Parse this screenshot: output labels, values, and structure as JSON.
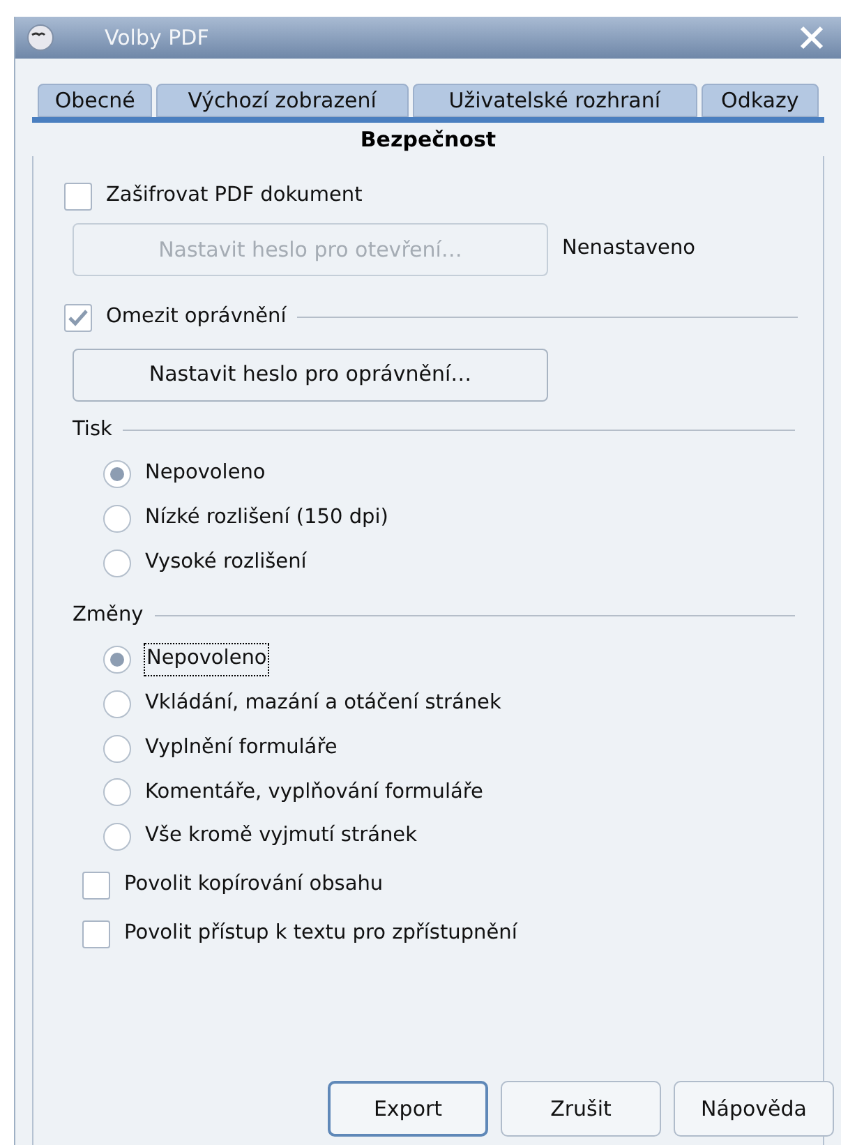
{
  "window": {
    "title": "Volby PDF"
  },
  "tab_rows": [
    [
      {
        "label": "Obecné",
        "selected": false
      },
      {
        "label": "Výchozí zobrazení",
        "selected": false
      },
      {
        "label": "Uživatelské rozhraní",
        "selected": false
      },
      {
        "label": "Odkazy",
        "selected": false
      }
    ],
    [
      {
        "label": "Bezpečnost",
        "selected": true
      }
    ]
  ],
  "encryption": {
    "checkbox": {
      "label": "Zašifrovat PDF dokument",
      "checked": false
    },
    "button": {
      "label": "Nastavit heslo pro otevření…",
      "disabled": true
    },
    "status": "Nenastaveno"
  },
  "permissions": {
    "checkbox": {
      "label": "Omezit oprávnění",
      "checked": true
    },
    "button": {
      "label": "Nastavit heslo pro oprávnění…",
      "disabled": false
    }
  },
  "groups": [
    {
      "title": "Tisk",
      "options": [
        {
          "label": "Nepovoleno",
          "selected": true,
          "focused": false
        },
        {
          "label": "Nízké rozlišení (150 dpi)",
          "selected": false,
          "focused": false
        },
        {
          "label": "Vysoké rozlišení",
          "selected": false,
          "focused": false
        }
      ]
    },
    {
      "title": "Změny",
      "options": [
        {
          "label": "Nepovoleno",
          "selected": true,
          "focused": true
        },
        {
          "label": "Vkládání, mazání a otáčení stránek",
          "selected": false,
          "focused": false
        },
        {
          "label": "Vyplnění formuláře",
          "selected": false,
          "focused": false
        },
        {
          "label": "Komentáře, vyplňování formuláře",
          "selected": false,
          "focused": false
        },
        {
          "label": "Vše kromě vyjmutí stránek",
          "selected": false,
          "focused": false
        }
      ]
    }
  ],
  "options": [
    {
      "label": "Povolit kopírování obsahu",
      "checked": false
    },
    {
      "label": "Povolit přístup k textu pro zpřístupnění",
      "checked": false
    }
  ],
  "buttons": [
    {
      "label": "Export",
      "default": true
    },
    {
      "label": "Zrušit",
      "default": false
    },
    {
      "label": "Nápověda",
      "default": false
    }
  ]
}
